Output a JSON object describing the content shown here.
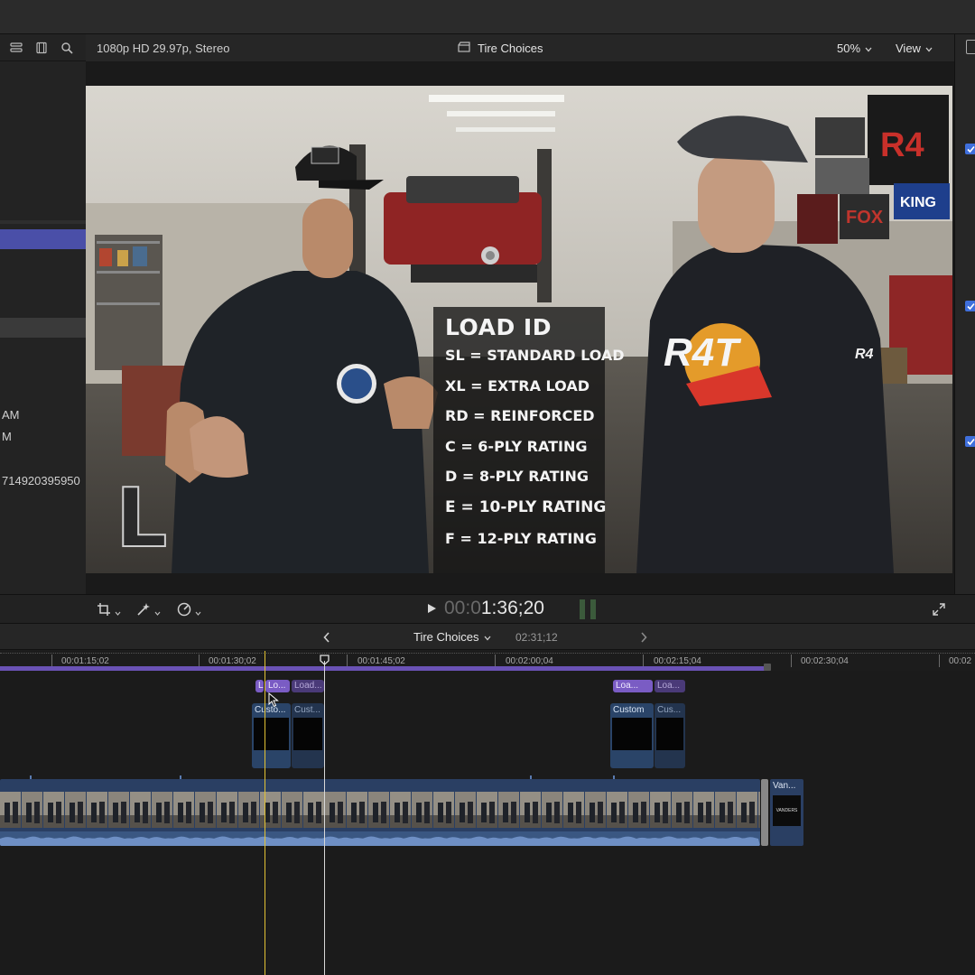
{
  "viewer": {
    "format": "1080p HD 29.97p, Stereo",
    "project_title": "Tire Choices",
    "zoom": "50%",
    "view_label": "View"
  },
  "left_panel": {
    "items": [
      "AM",
      "M",
      "714920395950"
    ]
  },
  "overlay": {
    "heading": "LOAD ID",
    "lines": [
      "SL = STANDARD LOAD",
      "XL = EXTRA LOAD",
      "RD = REINFORCED",
      "C = 6-PLY RATING",
      "D = 8-PLY RATING",
      "E = 10-PLY RATING",
      "F = 12-PLY RATING"
    ],
    "corner_letter": "L"
  },
  "shirt_text": {
    "right": "R4T",
    "sleeve": "R4",
    "banner_1": "R4",
    "banner_2": "KING",
    "banner_3": "FOX"
  },
  "playback": {
    "timecode_dim": "00:0",
    "timecode_bright": "1:36;20"
  },
  "timeline": {
    "title": "Tire Choices",
    "duration": "02:31;12",
    "ruler": [
      "00:01:15;02",
      "00:01:30;02",
      "00:01:45;02",
      "00:02:00;04",
      "00:02:15;04",
      "00:02:30;04",
      "00:02"
    ],
    "title_clips": [
      "L",
      "Lo...",
      "Load...",
      "Loa...",
      "Loa..."
    ],
    "generator_clips": [
      "Custo...",
      "Cust...",
      "Custom",
      "Cus..."
    ],
    "end_clip": "Van...",
    "end_clip_logo": "VANDERS"
  },
  "colors": {
    "accent_purple": "#7a5cc4",
    "clip_blue": "#2a3f63",
    "selection_blue": "#4a4fa8",
    "skimmer_yellow": "#e3c334"
  },
  "icons": [
    "libraries-icon",
    "filmstrip-icon",
    "search-icon",
    "clapper-icon",
    "crop-icon",
    "magic-wand-icon",
    "speed-icon",
    "play-icon",
    "fullscreen-icon",
    "chevron-left-icon",
    "chevron-right-icon"
  ]
}
